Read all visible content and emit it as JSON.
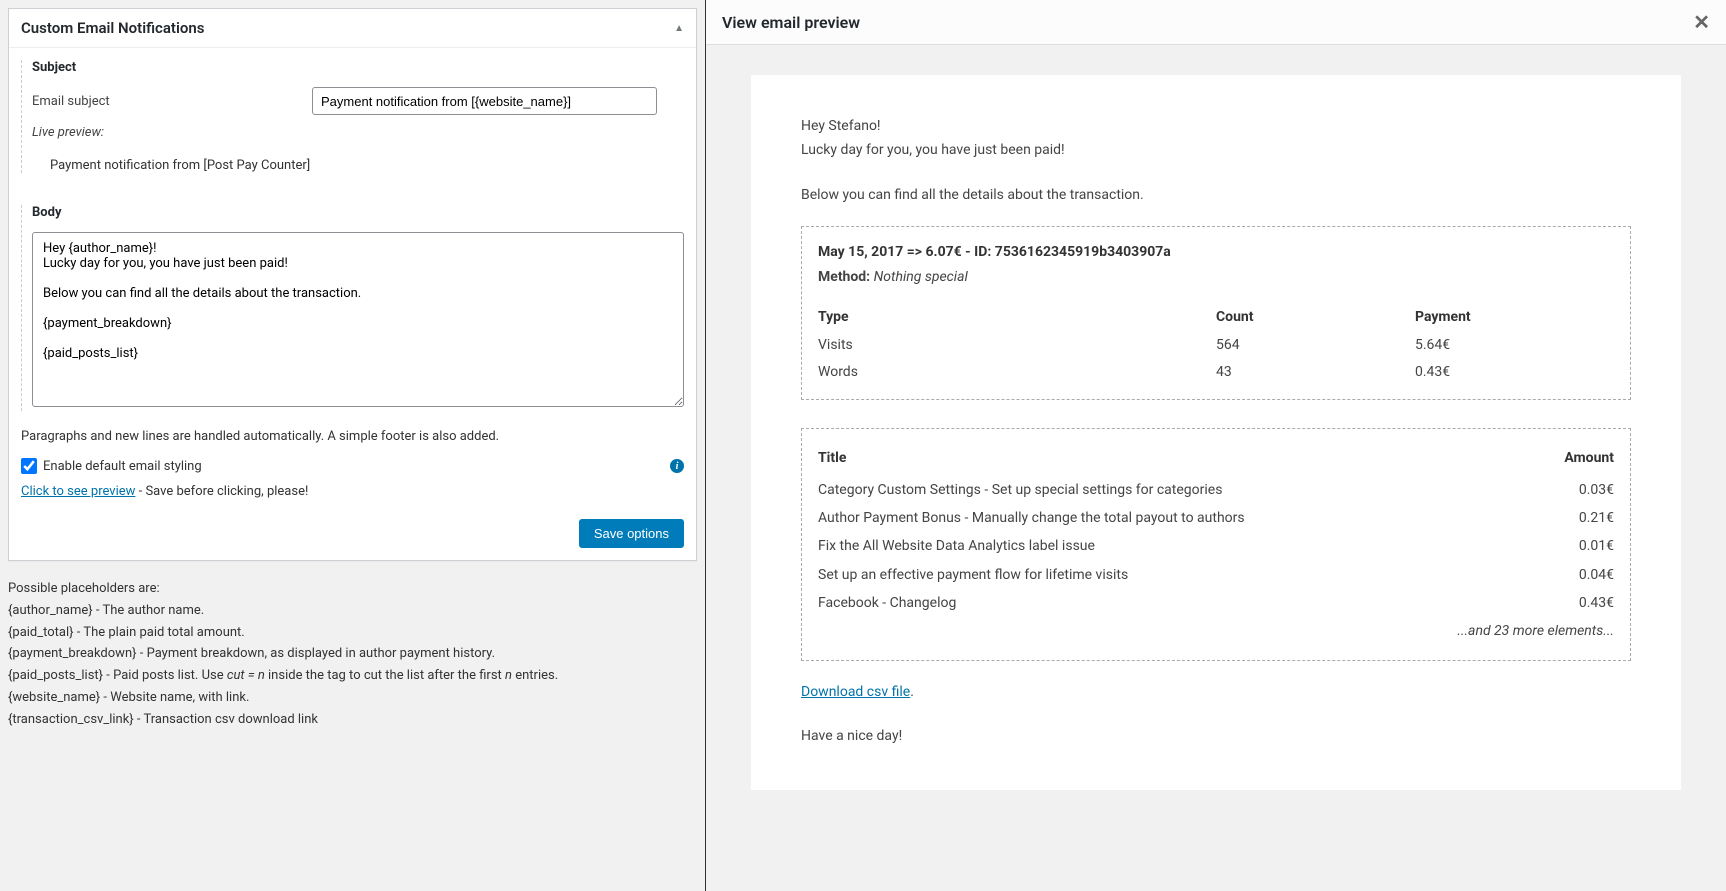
{
  "leftPanel": {
    "title": "Custom Email Notifications",
    "subject": {
      "sectionTitle": "Subject",
      "label": "Email subject",
      "value": "Payment notification from [{website_name}]",
      "livePreviewLabel": "Live preview:",
      "livePreviewText": "Payment notification from [Post Pay Counter]"
    },
    "body": {
      "sectionTitle": "Body",
      "value": "Hey {author_name}!\nLucky day for you, you have just been paid!\n\nBelow you can find all the details about the transaction.\n\n{payment_breakdown}\n\n{paid_posts_list}",
      "helpText": "Paragraphs and new lines are handled automatically. A simple footer is also added.",
      "enableStylingLabel": "Enable default email styling",
      "previewLink": "Click to see preview",
      "previewHint": " - Save before clicking, please!"
    },
    "saveButton": "Save options",
    "placeholders": {
      "intro": "Possible placeholders are:",
      "list": [
        "{author_name} - The author name.",
        "{paid_total} - The plain paid total amount.",
        "{payment_breakdown} - Payment breakdown, as displayed in author payment history.",
        "{paid_posts_list} - Paid posts list. Use cut = n inside the tag to cut the list after the first n entries.",
        "{website_name} - Website name, with link.",
        "{transaction_csv_link} - Transaction csv download link"
      ]
    }
  },
  "rightPanel": {
    "title": "View email preview",
    "email": {
      "greeting": "Hey Stefano!",
      "line1": "Lucky day for you, you have just been paid!",
      "line2": "Below you can find all the details about the transaction.",
      "breakdown": {
        "header": "May 15, 2017 => 6.07€ - ID: 7536162345919b3403907a",
        "methodLabel": "Method:",
        "methodValue": "Nothing special",
        "columns": [
          "Type",
          "Count",
          "Payment"
        ],
        "rows": [
          {
            "type": "Visits",
            "count": "564",
            "payment": "5.64€"
          },
          {
            "type": "Words",
            "count": "43",
            "payment": "0.43€"
          }
        ]
      },
      "posts": {
        "columns": [
          "Title",
          "Amount"
        ],
        "rows": [
          {
            "title": "Category Custom Settings - Set up special settings for categories",
            "amount": "0.03€"
          },
          {
            "title": "Author Payment Bonus - Manually change the total payout to authors",
            "amount": "0.21€"
          },
          {
            "title": "Fix the All Website Data Analytics label issue",
            "amount": "0.01€"
          },
          {
            "title": "Set up an effective payment flow for lifetime visits",
            "amount": "0.04€"
          },
          {
            "title": "Facebook - Changelog",
            "amount": "0.43€"
          }
        ],
        "more": "...and 23 more elements..."
      },
      "csvLink": "Download csv file",
      "closing": "Have a nice day!"
    }
  },
  "chart_data": {
    "type": "table",
    "title": "Payment breakdown",
    "columns": [
      "Type",
      "Count",
      "Payment (€)"
    ],
    "rows": [
      [
        "Visits",
        564,
        5.64
      ],
      [
        "Words",
        43,
        0.43
      ]
    ]
  }
}
